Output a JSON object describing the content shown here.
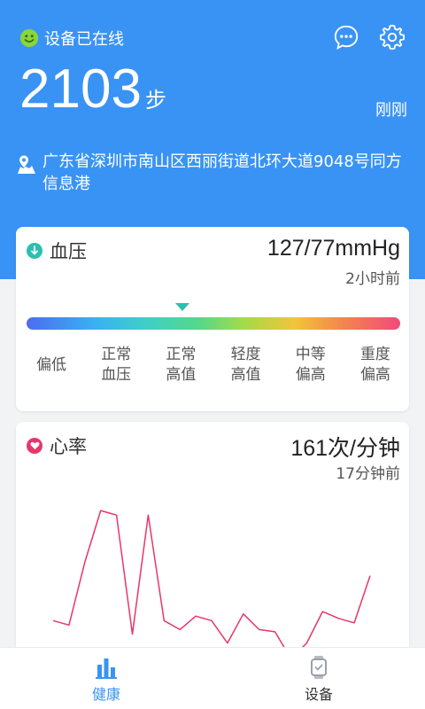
{
  "header": {
    "status": "设备已在线",
    "steps": "2103",
    "steps_unit": "步",
    "updated": "刚刚",
    "address": "广东省深圳市南山区西丽街道北环大道9048号同方信息港"
  },
  "blood_pressure": {
    "title": "血压",
    "value": "127/77mmHg",
    "time": "2小时前",
    "levels": [
      "偏低",
      "正常\n血压",
      "正常\n高值",
      "轻度\n高值",
      "中等\n偏高",
      "重度\n偏高"
    ]
  },
  "heart_rate": {
    "title": "心率",
    "value": "161次/分钟",
    "time": "17分钟前"
  },
  "chart_data": {
    "type": "line",
    "series": [
      {
        "values": [
          62,
          60,
          88,
          111,
          109,
          56,
          109,
          62,
          58,
          64,
          62,
          52,
          65,
          58,
          57,
          45,
          52,
          66,
          63,
          61,
          82
        ]
      }
    ],
    "color": "#e8356b"
  },
  "tabs": [
    {
      "label": "健康",
      "icon": "bar-chart-icon",
      "active": true
    },
    {
      "label": "设备",
      "icon": "watch-icon",
      "active": false
    }
  ],
  "colors": {
    "primary": "#3993f4",
    "accent": "#e8356b",
    "online": "#7ed321"
  }
}
